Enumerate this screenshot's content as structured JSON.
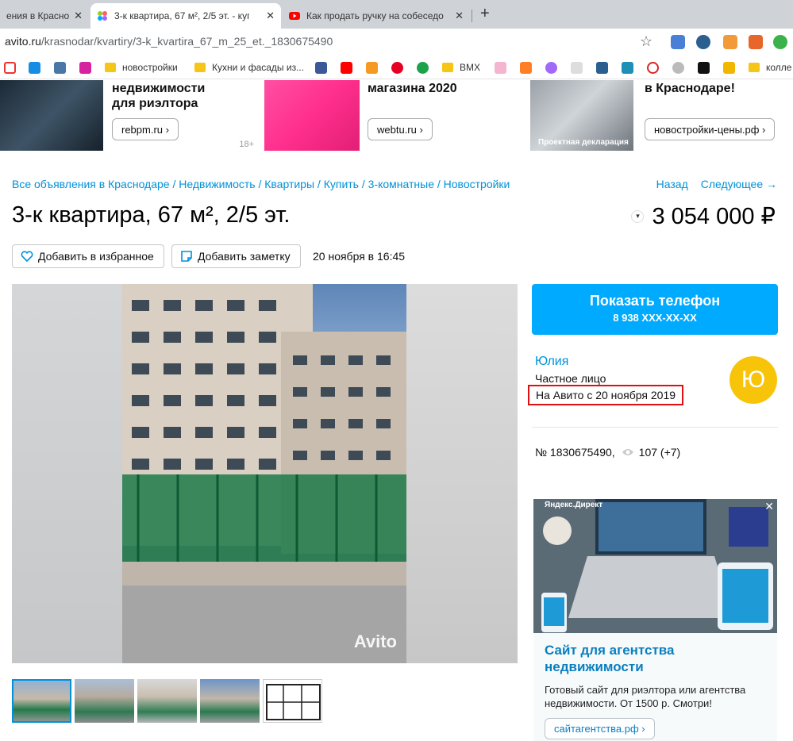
{
  "browser": {
    "tabs": [
      {
        "title": "ения в Красно",
        "active": false
      },
      {
        "title": "3-к квартира, 67 м², 2/5 эт. - куп",
        "active": true
      },
      {
        "title": "Как продать ручку на собеседо",
        "active": false
      }
    ],
    "url": {
      "host": "avito.ru",
      "path": "/krasnodar/kvartiry/3-k_kvartira_67_m_25_et._1830675490"
    },
    "bookmarks": [
      "новостройки",
      "Кухни и фасады из...",
      "BMX",
      "колле"
    ]
  },
  "top_ads": [
    {
      "title": "недвижимости\nдля риэлтора",
      "button": "rebpm.ru ›",
      "age": "18+"
    },
    {
      "title": "магазина 2020",
      "button": "webtu.ru ›"
    },
    {
      "title": "в Краснодаре!",
      "button": "новостройки-цены.рф ›",
      "caption": "Проектная декларация"
    }
  ],
  "breadcrumbs": [
    "Все объявления в Краснодаре",
    "Недвижимость",
    "Квартиры",
    "Купить",
    "3-комнатные",
    "Новостройки"
  ],
  "nav": {
    "back": "Назад",
    "next": "Следующее →"
  },
  "listing": {
    "title": "3-к квартира, 67 м², 2/5 эт.",
    "price": "3 054 000 ₽",
    "add_favorite": "Добавить в избранное",
    "add_note": "Добавить заметку",
    "date": "20 ноября в 16:45",
    "watermark": "Avito",
    "id_text": "№ 1830675490,",
    "views": "107 (+7)"
  },
  "contact": {
    "button_label": "Показать телефон",
    "phone_masked": "8 938 XXX-XX-XX"
  },
  "seller": {
    "name": "Юлия",
    "type": "Частное лицо",
    "since": "На Авито с 20 ноября 2019",
    "avatar_letter": "Ю"
  },
  "right_ad": {
    "label": "Яндекс.Директ",
    "title": "Сайт для агентства\nнедвижимости",
    "description": "Готовый сайт для риэлтора или агентства\nнедвижимости. От 1500 р. Смотри!",
    "button": "сайтагентства.рф ›"
  },
  "colors": {
    "accent": "#00aaff",
    "link": "#0091d9",
    "highlight": "#e01010",
    "avatar": "#f8c40a"
  }
}
